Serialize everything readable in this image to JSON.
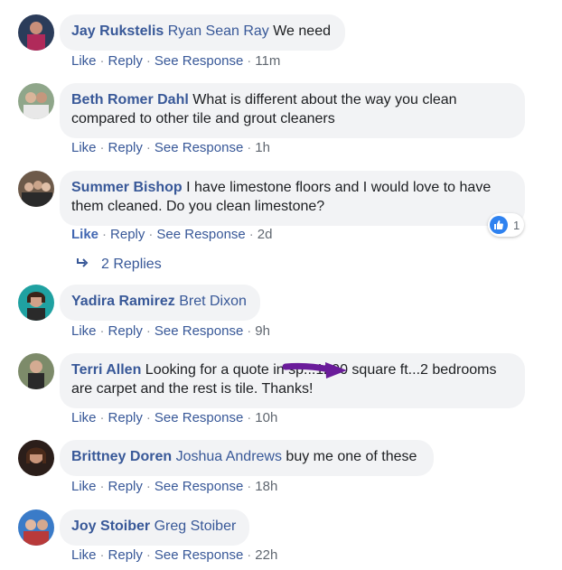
{
  "actions": {
    "like": "Like",
    "reply": "Reply",
    "see_response": "See Response",
    "sep": "·"
  },
  "comments": [
    {
      "author": "Jay Rukstelis",
      "tag": "Ryan Sean Ray",
      "text": " We need",
      "time": "11m"
    },
    {
      "author": "Beth Romer Dahl",
      "tag": "",
      "text": " What is different about the way you clean compared to other tile and grout cleaners",
      "time": "1h"
    },
    {
      "author": "Summer Bishop",
      "tag": "",
      "text": " I have limestone floors and I would love to have them cleaned. Do you clean limestone?",
      "time": "2d",
      "liked": true,
      "reaction_count": "1"
    },
    {
      "author": "Yadira Ramirez",
      "tag": "Bret Dixon",
      "text": "",
      "time": "9h"
    },
    {
      "author": "Terri Allen",
      "tag": "",
      "text": " Looking for a quote in sp...1200 square ft...2 bedrooms are carpet and the rest is tile. Thanks!",
      "time": "10h"
    },
    {
      "author": "Brittney Doren",
      "tag": "Joshua Andrews",
      "text": " buy me one of these",
      "time": "18h"
    },
    {
      "author": "Joy Stoiber",
      "tag": "Greg Stoiber",
      "text": "",
      "time": "22h"
    }
  ],
  "replies_label": "2 Replies",
  "icons": {
    "reply_arrow": "reply-arrow-icon",
    "like_badge": "thumbs-up-icon"
  },
  "colors": {
    "link": "#385898",
    "bubble": "#f2f3f5",
    "like_blue": "#2f82f0",
    "annotation_arrow": "#6a1b9a"
  }
}
